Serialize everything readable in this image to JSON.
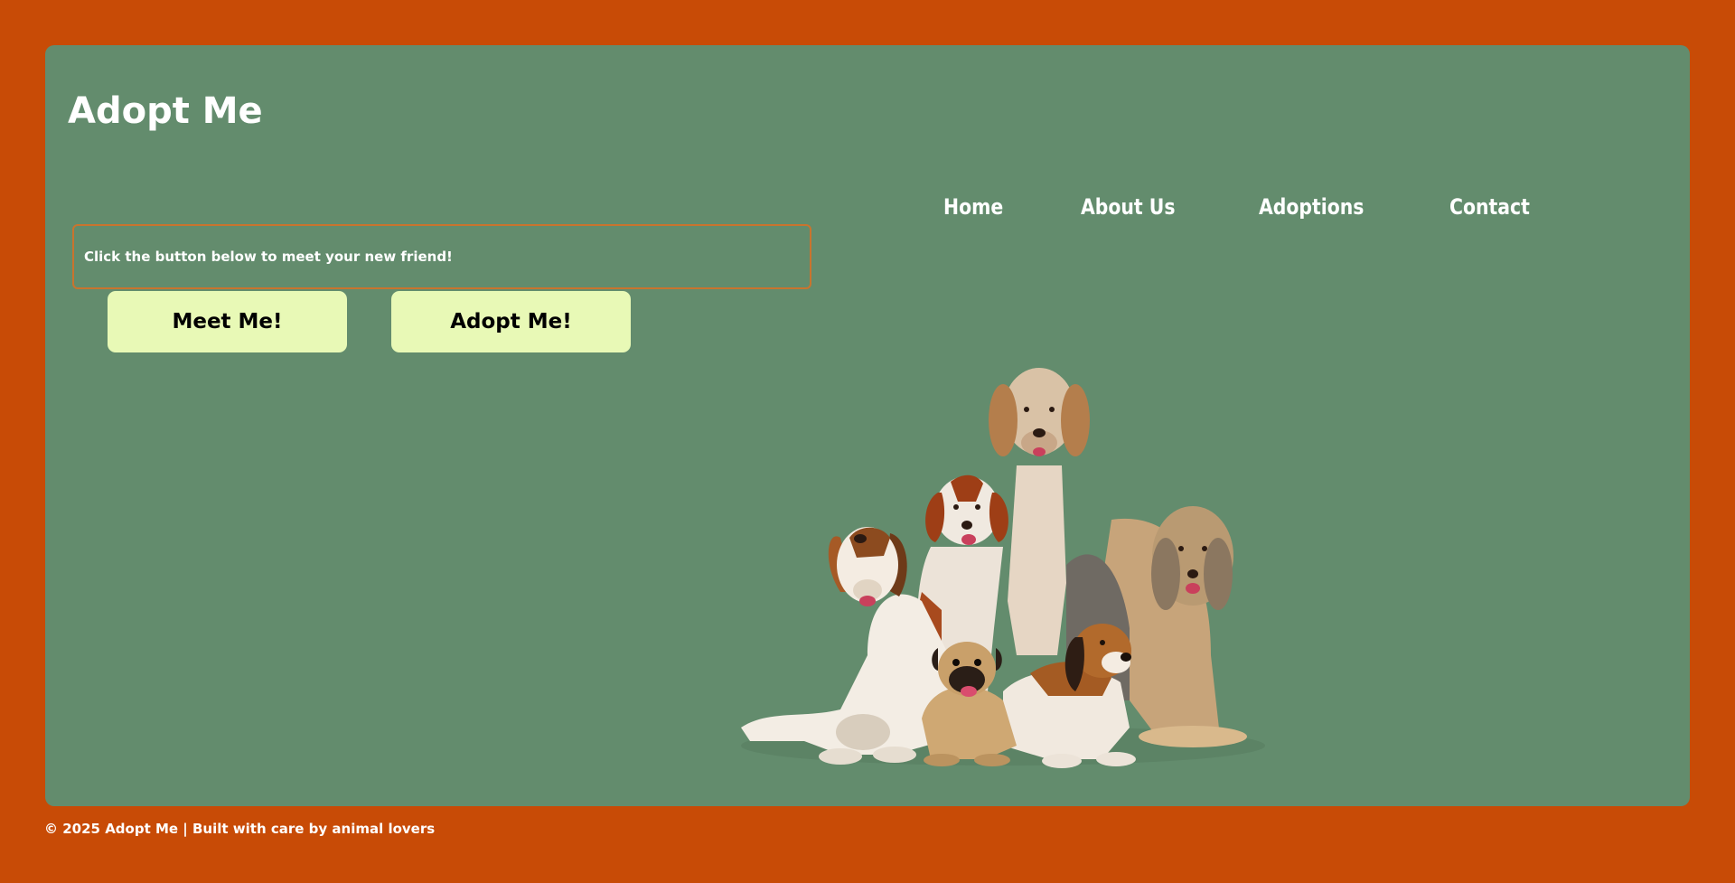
{
  "header": {
    "title": "Adopt Me"
  },
  "nav": {
    "items": [
      "Home",
      "About Us",
      "Adoptions",
      "Contact"
    ]
  },
  "main": {
    "message": "Click the button below to meet your new friend!",
    "buttons": {
      "meet": "Meet Me!",
      "adopt": "Adopt Me!"
    },
    "image": {
      "alt": "group of dogs"
    }
  },
  "footer": {
    "text": "© 2025 Adopt Me | Built with care by animal lovers"
  },
  "colors": {
    "background": "#c84b06",
    "panel": "#638c6d",
    "button": "#e8f9b6",
    "message_border": "#c9742e"
  }
}
